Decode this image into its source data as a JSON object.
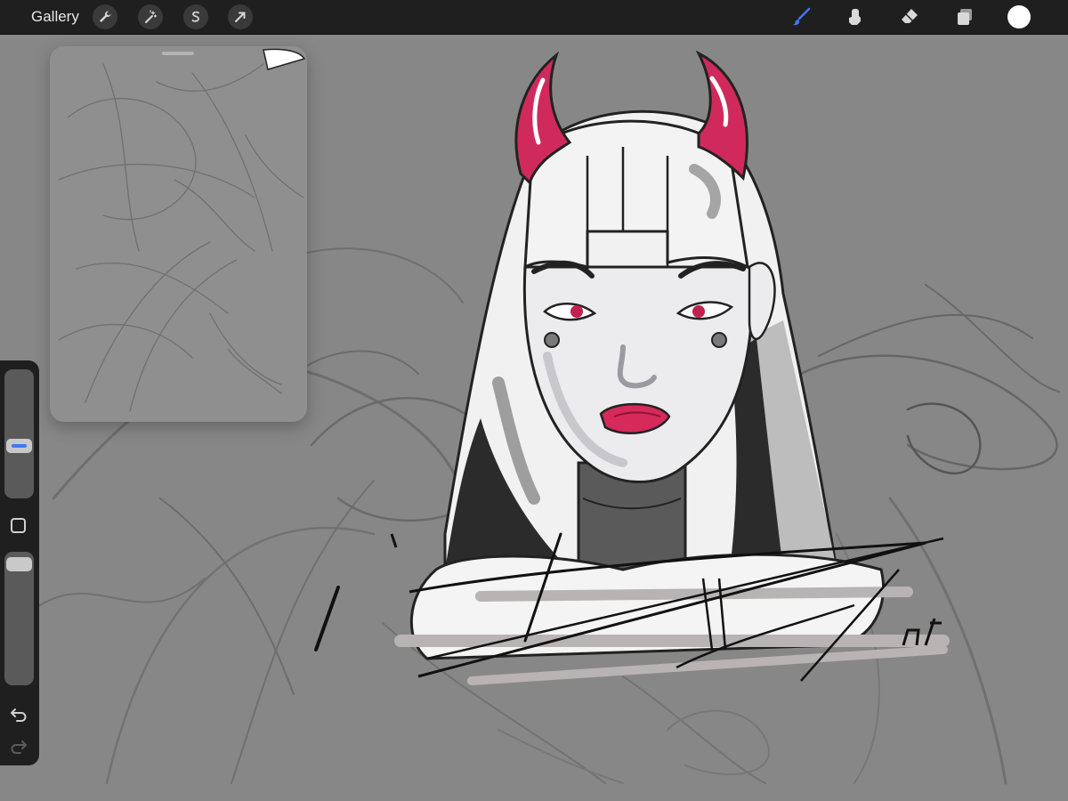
{
  "app": {
    "gallery_label": "Gallery"
  },
  "toolbar": {
    "left_tools": [
      {
        "name": "actions",
        "icon": "wrench-icon"
      },
      {
        "name": "adjustments",
        "icon": "magic-wand-icon"
      },
      {
        "name": "selection",
        "icon": "selection-s-icon"
      },
      {
        "name": "transform",
        "icon": "arrow-cursor-icon"
      }
    ],
    "right_tools": [
      {
        "name": "brush",
        "icon": "brush-icon",
        "active": true
      },
      {
        "name": "smudge",
        "icon": "smudge-icon",
        "active": false
      },
      {
        "name": "eraser",
        "icon": "eraser-icon",
        "active": false
      },
      {
        "name": "layers",
        "icon": "layers-icon",
        "active": false
      }
    ],
    "current_color": "#ffffff",
    "active_color": "#3d7bf0"
  },
  "sidebar": {
    "brush_size_icon": "slider-knob",
    "modify_icon": "square-icon",
    "undo_icon": "undo-icon",
    "redo_icon": "redo-icon"
  },
  "canvas": {
    "background": "#878787",
    "accent_colors": {
      "horns": "#d02a5c",
      "lips": "#d52a5a",
      "eyes": "#c2204f",
      "skin": "#eeeeef",
      "hair_dark": "#2b2b2b"
    }
  }
}
